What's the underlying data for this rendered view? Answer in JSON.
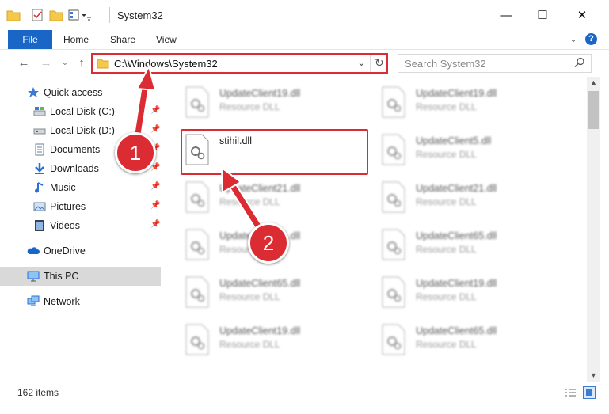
{
  "window": {
    "title": "System32",
    "controls": {
      "minimize": "—",
      "maximize": "☐",
      "close": "✕"
    }
  },
  "ribbon": {
    "tabs": [
      "File",
      "Home",
      "Share",
      "View"
    ],
    "help_icon": "?"
  },
  "address_bar": {
    "path": "C:\\Windows\\System32",
    "search_placeholder": "Search System32"
  },
  "sidebar": {
    "items": [
      {
        "label": "Quick access",
        "icon": "star-icon"
      },
      {
        "label": "Local Disk (C:)",
        "icon": "drive-icon",
        "pinned": true
      },
      {
        "label": "Local Disk (D:)",
        "icon": "drive-icon",
        "pinned": true
      },
      {
        "label": "Documents",
        "icon": "documents-icon",
        "pinned": true
      },
      {
        "label": "Downloads",
        "icon": "downloads-icon",
        "pinned": true
      },
      {
        "label": "Music",
        "icon": "music-icon",
        "pinned": true
      },
      {
        "label": "Pictures",
        "icon": "pictures-icon",
        "pinned": true
      },
      {
        "label": "Videos",
        "icon": "videos-icon",
        "pinned": true
      },
      {
        "label": "OneDrive",
        "icon": "cloud-icon"
      },
      {
        "label": "This PC",
        "icon": "computer-icon",
        "selected": true
      },
      {
        "label": "Network",
        "icon": "network-icon"
      }
    ]
  },
  "files": {
    "left": [
      {
        "name": "UpdateClient19.dll",
        "type": "Resource DLL",
        "blurred": true
      },
      {
        "name": "stihil.dll",
        "type": "",
        "blurred": false,
        "highlighted": true
      },
      {
        "name": "UpdateClient21.dll",
        "type": "Resource DLL",
        "blurred": true
      },
      {
        "name": "UpdateClient21.dll",
        "type": "Resource DLL",
        "blurred": true
      },
      {
        "name": "UpdateClient65.dll",
        "type": "Resource DLL",
        "blurred": true
      },
      {
        "name": "UpdateClient19.dll",
        "type": "Resource DLL",
        "blurred": true
      }
    ],
    "right": [
      {
        "name": "UpdateClient19.dll",
        "type": "Resource DLL",
        "blurred": true
      },
      {
        "name": "UpdateClient5.dll",
        "type": "Resource DLL",
        "blurred": true
      },
      {
        "name": "UpdateClient21.dll",
        "type": "Resource DLL",
        "blurred": true
      },
      {
        "name": "UpdateClient65.dll",
        "type": "Resource DLL",
        "blurred": true
      },
      {
        "name": "UpdateClient19.dll",
        "type": "Resource DLL",
        "blurred": true
      },
      {
        "name": "UpdateClient65.dll",
        "type": "Resource DLL",
        "blurred": true
      }
    ]
  },
  "status": {
    "item_count": "162 items"
  },
  "annotations": {
    "step1": "1",
    "step2": "2"
  },
  "colors": {
    "accent": "#1a66c6",
    "annotation_red": "#dc2c33",
    "selected_bg": "#d9d9d9"
  }
}
